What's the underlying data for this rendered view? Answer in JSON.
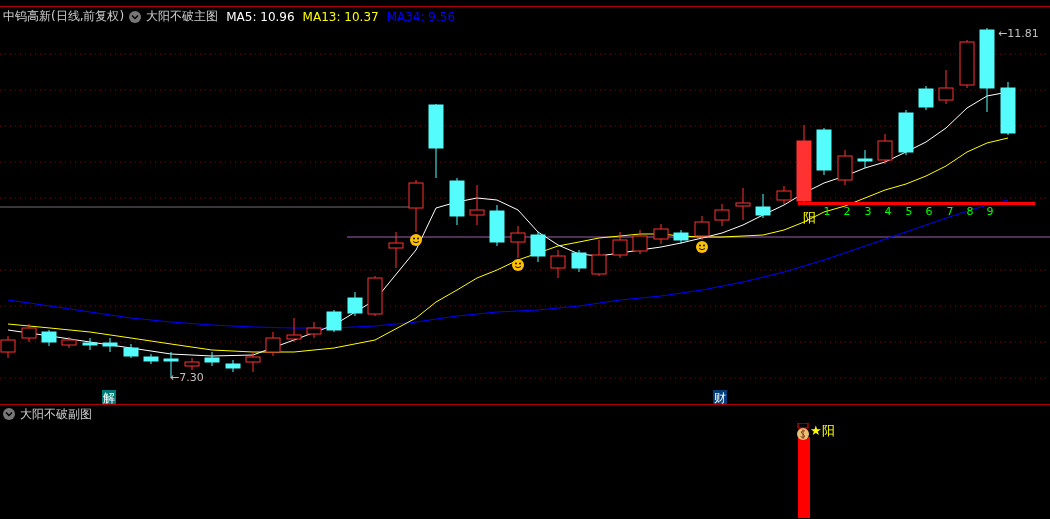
{
  "header": {
    "stock": "中钨高新(日线,前复权)",
    "indicator": "大阳不破主图",
    "ma": [
      {
        "label": "MA5: 10.96",
        "color": "#ffffff"
      },
      {
        "label": "MA13: 10.37",
        "color": "#ffff00"
      },
      {
        "label": "MA34: 9.56",
        "color": "#0000ff"
      }
    ]
  },
  "price_labels": {
    "high": "←11.81",
    "low": "←7.30"
  },
  "markers": [
    {
      "text": "解",
      "color": "#007878"
    },
    {
      "text": "财",
      "color": "#003c78"
    }
  ],
  "signal_label": "阳",
  "counts": [
    "1",
    "2",
    "3",
    "4",
    "5",
    "6",
    "7",
    "8",
    "9"
  ],
  "sub_panel": {
    "title": "大阳不破副图",
    "signal": "★阳"
  }
}
